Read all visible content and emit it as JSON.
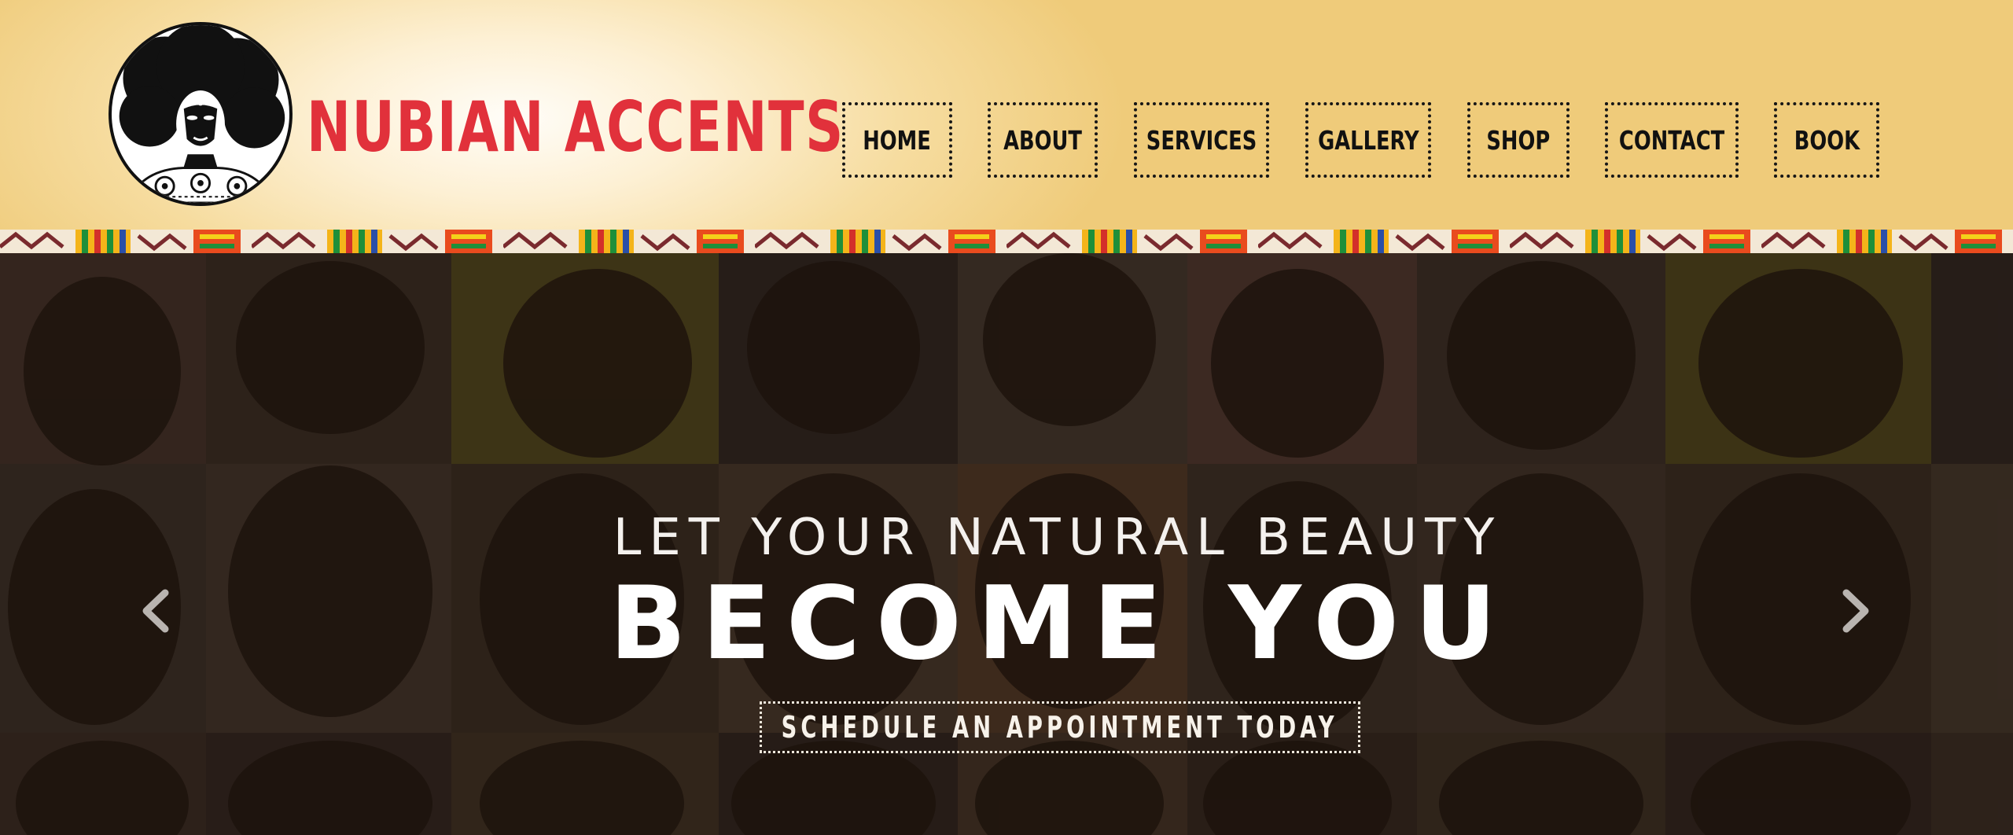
{
  "brand": {
    "name": "NUBIAN ACCENTS",
    "emblem_icon": "afro-woman-portrait-icon",
    "name_color": "#e1313b"
  },
  "nav": {
    "items": [
      {
        "label": "HOME"
      },
      {
        "label": "ABOUT"
      },
      {
        "label": "SERVICES"
      },
      {
        "label": "GALLERY"
      },
      {
        "label": "SHOP"
      },
      {
        "label": "CONTACT"
      },
      {
        "label": "BOOK"
      }
    ]
  },
  "hero": {
    "subtitle": "LET YOUR NATURAL BEAUTY",
    "title": "BECOME YOU",
    "cta_label": "SCHEDULE AN APPOINTMENT TODAY",
    "prev_icon": "chevron-left-icon",
    "next_icon": "chevron-right-icon"
  },
  "colors": {
    "header_gold": "#efcb7a",
    "accent_red": "#e1313b",
    "overlay": "#160e0a"
  }
}
